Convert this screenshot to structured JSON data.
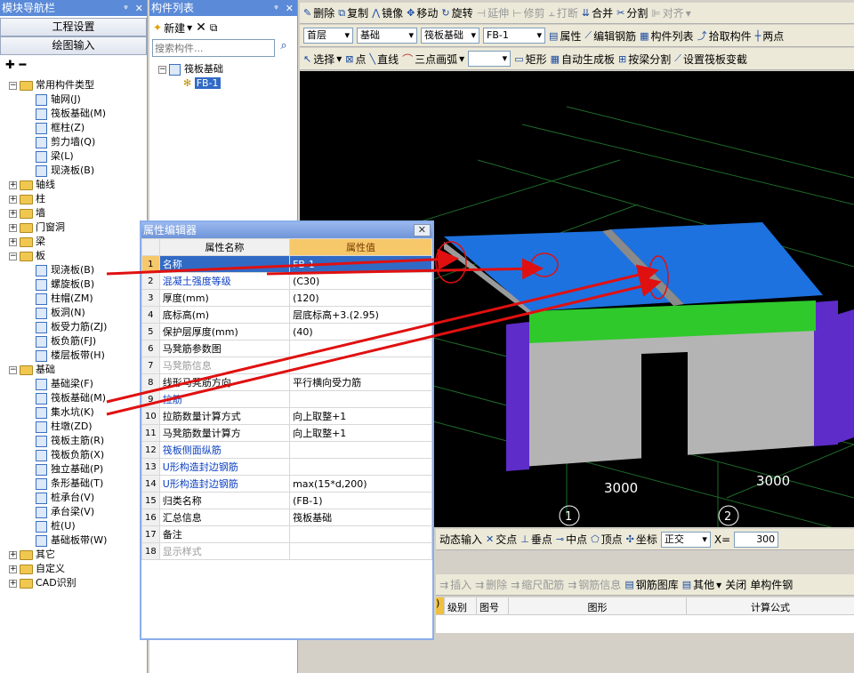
{
  "nav": {
    "title": "模块导航栏",
    "pin": "ᵠ",
    "close": "✕",
    "btn_project": "工程设置",
    "btn_draw": "绘图输入",
    "items": [
      {
        "t": "常用构件类型",
        "lvl": 0,
        "exp": "−",
        "folder": true
      },
      {
        "t": "轴网(J)",
        "lvl": 1
      },
      {
        "t": "筏板基础(M)",
        "lvl": 1
      },
      {
        "t": "框柱(Z)",
        "lvl": 1
      },
      {
        "t": "剪力墙(Q)",
        "lvl": 1
      },
      {
        "t": "梁(L)",
        "lvl": 1
      },
      {
        "t": "现浇板(B)",
        "lvl": 1
      },
      {
        "t": "轴线",
        "lvl": 0,
        "exp": "+",
        "folder": true
      },
      {
        "t": "柱",
        "lvl": 0,
        "exp": "+",
        "folder": true
      },
      {
        "t": "墙",
        "lvl": 0,
        "exp": "+",
        "folder": true
      },
      {
        "t": "门窗洞",
        "lvl": 0,
        "exp": "+",
        "folder": true
      },
      {
        "t": "梁",
        "lvl": 0,
        "exp": "+",
        "folder": true
      },
      {
        "t": "板",
        "lvl": 0,
        "exp": "−",
        "folder": true
      },
      {
        "t": "现浇板(B)",
        "lvl": 1
      },
      {
        "t": "螺旋板(B)",
        "lvl": 1
      },
      {
        "t": "柱帽(ZM)",
        "lvl": 1
      },
      {
        "t": "板洞(N)",
        "lvl": 1
      },
      {
        "t": "板受力筋(ZJ)",
        "lvl": 1
      },
      {
        "t": "板负筋(FJ)",
        "lvl": 1
      },
      {
        "t": "楼层板带(H)",
        "lvl": 1
      },
      {
        "t": "基础",
        "lvl": 0,
        "exp": "−",
        "folder": true
      },
      {
        "t": "基础梁(F)",
        "lvl": 1
      },
      {
        "t": "筏板基础(M)",
        "lvl": 1
      },
      {
        "t": "集水坑(K)",
        "lvl": 1
      },
      {
        "t": "柱墩(ZD)",
        "lvl": 1
      },
      {
        "t": "筏板主筋(R)",
        "lvl": 1
      },
      {
        "t": "筏板负筋(X)",
        "lvl": 1
      },
      {
        "t": "独立基础(P)",
        "lvl": 1
      },
      {
        "t": "条形基础(T)",
        "lvl": 1
      },
      {
        "t": "桩承台(V)",
        "lvl": 1
      },
      {
        "t": "承台梁(V)",
        "lvl": 1
      },
      {
        "t": "桩(U)",
        "lvl": 1
      },
      {
        "t": "基础板带(W)",
        "lvl": 1
      },
      {
        "t": "其它",
        "lvl": 0,
        "exp": "+",
        "folder": true
      },
      {
        "t": "自定义",
        "lvl": 0,
        "exp": "+",
        "folder": true
      },
      {
        "t": "CAD识别",
        "lvl": 0,
        "exp": "+",
        "folder": true
      }
    ]
  },
  "complist": {
    "title": "构件列表",
    "new_label": "新建",
    "search_placeholder": "搜索构件...",
    "root": "筏板基础",
    "child": "FB-1"
  },
  "toolbar1": {
    "delete": "删除",
    "copy": "复制",
    "mirror": "镜像",
    "move": "移动",
    "rotate": "旋转",
    "extend": "延伸",
    "trim": "修剪",
    "break": "打断",
    "merge": "合并",
    "split": "分割",
    "align": "对齐"
  },
  "toolbar2": {
    "floor": "首层",
    "type": "基础",
    "comp": "筏板基础",
    "name": "FB-1",
    "attr": "属性",
    "edit_rebar": "编辑钢筋",
    "list": "构件列表",
    "pick": "拾取构件",
    "two_pt": "两点"
  },
  "toolbar3": {
    "select": "选择",
    "point": "点",
    "line": "直线",
    "arc": "三点画弧",
    "rect": "矩形",
    "auto": "自动生成板",
    "by_beam": "按梁分割",
    "set_slope": "设置筏板变截"
  },
  "prop": {
    "title": "属性编辑器",
    "h_name": "属性名称",
    "h_val": "属性值",
    "rows": [
      {
        "n": "1",
        "name": "名称",
        "val": "FB-1",
        "blue": false
      },
      {
        "n": "2",
        "name": "混凝土强度等级",
        "val": "(C30)",
        "blue": true
      },
      {
        "n": "3",
        "name": "厚度(mm)",
        "val": "(120)",
        "blue": false
      },
      {
        "n": "4",
        "name": "底标高(m)",
        "val": "层底标高+3.(2.95)",
        "blue": false
      },
      {
        "n": "5",
        "name": "保护层厚度(mm)",
        "val": "(40)",
        "blue": false
      },
      {
        "n": "6",
        "name": "马凳筋参数图",
        "val": "",
        "blue": false
      },
      {
        "n": "7",
        "name": "马凳筋信息",
        "val": "",
        "blue": false,
        "dim": true
      },
      {
        "n": "8",
        "name": "线形马凳筋方向",
        "val": "平行横向受力筋",
        "blue": false
      },
      {
        "n": "9",
        "name": "拉筋",
        "val": "",
        "blue": true
      },
      {
        "n": "10",
        "name": "拉筋数量计算方式",
        "val": "向上取整+1",
        "blue": false
      },
      {
        "n": "11",
        "name": "马凳筋数量计算方",
        "val": "向上取整+1",
        "blue": false
      },
      {
        "n": "12",
        "name": "筏板侧面纵筋",
        "val": "",
        "blue": true
      },
      {
        "n": "13",
        "name": "U形构造封边钢筋",
        "val": "",
        "blue": true
      },
      {
        "n": "14",
        "name": "U形构造封边钢筋",
        "val": "max(15*d,200)",
        "blue": true
      },
      {
        "n": "15",
        "name": "归类名称",
        "val": "(FB-1)",
        "blue": false
      },
      {
        "n": "16",
        "name": "汇总信息",
        "val": "筏板基础",
        "blue": false
      },
      {
        "n": "17",
        "name": "备注",
        "val": "",
        "blue": false
      },
      {
        "n": "18",
        "name": "显示样式",
        "val": "",
        "blue": false,
        "dim": true
      }
    ]
  },
  "viewport": {
    "dim1": "3000",
    "dim2": "3000",
    "axis1": "1",
    "axis2": "2"
  },
  "snapbar": {
    "dyn": "动态输入",
    "cross": "交点",
    "perp": "垂点",
    "mid": "中点",
    "vertex": "顶点",
    "coord": "坐标",
    "ortho": "正交",
    "x_label": "X=",
    "x_val": "300"
  },
  "rebarbar": {
    "insert": "插入",
    "delete": "删除",
    "scale": "缩尺配筋",
    "info": "钢筋信息",
    "lib": "钢筋图库",
    "other": "其他",
    "close": "关闭",
    "single": "单构件钢"
  },
  "rebargrid": {
    "c0": ")",
    "c1": "级别",
    "c2": "图号",
    "c3": "图形",
    "c4": "计算公式"
  }
}
